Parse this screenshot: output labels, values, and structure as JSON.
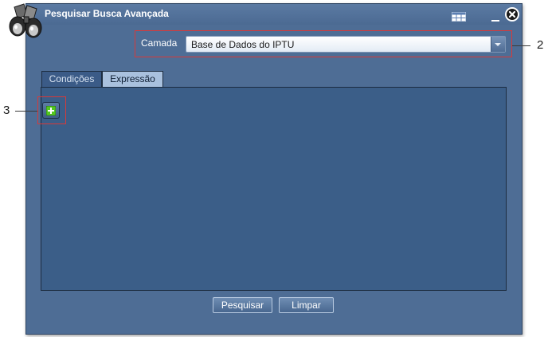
{
  "window": {
    "title": "Pesquisar Busca Avançada",
    "icons": [
      "binoculars-icon",
      "grid-icon",
      "minimize-icon",
      "close-icon"
    ]
  },
  "layer": {
    "label": "Camada",
    "selected": "Base de Dados do IPTU"
  },
  "tabs": [
    {
      "label": "Condições",
      "active": true
    },
    {
      "label": "Expressão",
      "active": false
    }
  ],
  "actions": {
    "search_label": "Pesquisar",
    "clear_label": "Limpar"
  },
  "callouts": {
    "layer_select": "2",
    "add_button": "3"
  },
  "colors": {
    "window_bg": "#4e6d95",
    "panel_bg": "#3b5e88",
    "callout_red": "#d63a3a",
    "add_icon_green": "#52c81e"
  }
}
